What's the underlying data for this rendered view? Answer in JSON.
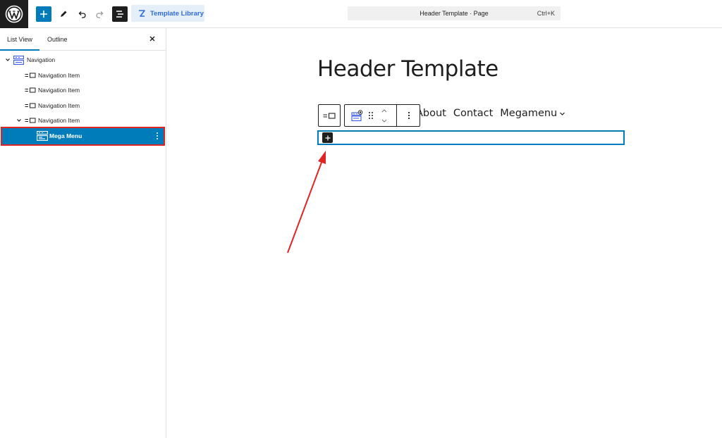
{
  "topbar": {
    "template_library_label": "Template Library",
    "command_center_title": "Header Template · Page",
    "command_center_shortcut": "Ctrl+K"
  },
  "sidebar": {
    "tabs": [
      {
        "label": "List View",
        "active": true
      },
      {
        "label": "Outline",
        "active": false
      }
    ],
    "tree": [
      {
        "label": "Navigation",
        "level": 0,
        "expanded": true,
        "icon": "navigation-block-icon"
      },
      {
        "label": "Navigation Item",
        "level": 1,
        "icon": "navigation-item-icon"
      },
      {
        "label": "Navigation Item",
        "level": 1,
        "icon": "navigation-item-icon"
      },
      {
        "label": "Navigation Item",
        "level": 1,
        "icon": "navigation-item-icon"
      },
      {
        "label": "Navigation Item",
        "level": 1,
        "expanded": true,
        "icon": "navigation-item-icon"
      },
      {
        "label": "Mega Menu",
        "level": 2,
        "selected": true,
        "icon": "mega-menu-block-icon"
      }
    ]
  },
  "canvas": {
    "page_title": "Header Template",
    "nav_items": [
      "About",
      "Contact",
      "Megamenu"
    ]
  },
  "colors": {
    "accent": "#007cba",
    "annotation": "#e02424",
    "template_library_bg": "#e5effa",
    "template_library_text": "#2e6bd8"
  }
}
